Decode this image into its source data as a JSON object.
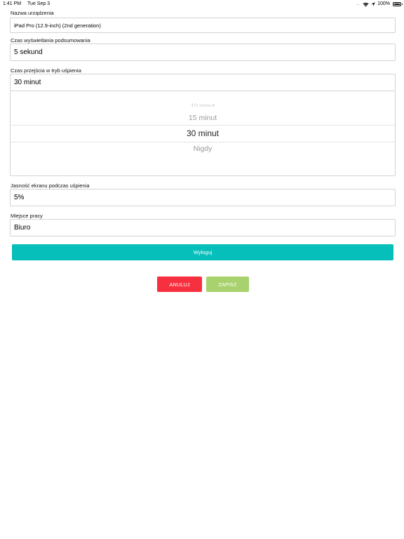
{
  "status_bar": {
    "time": "1:41 PM",
    "date": "Tue Sep 3",
    "signal": ".....",
    "battery_percent": "100%",
    "icons": [
      "wifi-icon",
      "location-icon",
      "battery-icon"
    ]
  },
  "form": {
    "device_name": {
      "label": "Nazwa urządzenia",
      "value": "iPad Pro (12.9-inch) (2nd generation)"
    },
    "summary_time": {
      "label": "Czas wyświetlania podsumowania",
      "value": "5 sekund"
    },
    "sleep_time": {
      "label": "Czas przejścia w tryb uśpienia",
      "value": "30 minut",
      "picker_options": [
        "10 minut",
        "15 minut",
        "30 minut",
        "Nigdy"
      ],
      "picker_selected": "30 minut"
    },
    "sleep_brightness": {
      "label": "Jasność ekranu podczas uśpienia",
      "value": "5%"
    },
    "workplace": {
      "label": "Miejsce pracy",
      "value": "Biuro"
    }
  },
  "buttons": {
    "logout": "Wyloguj",
    "cancel": "ANULUJ",
    "save": "ZAPISZ"
  },
  "colors": {
    "logout": "#06bfba",
    "cancel": "#f6303e",
    "save": "#a8d26e"
  }
}
